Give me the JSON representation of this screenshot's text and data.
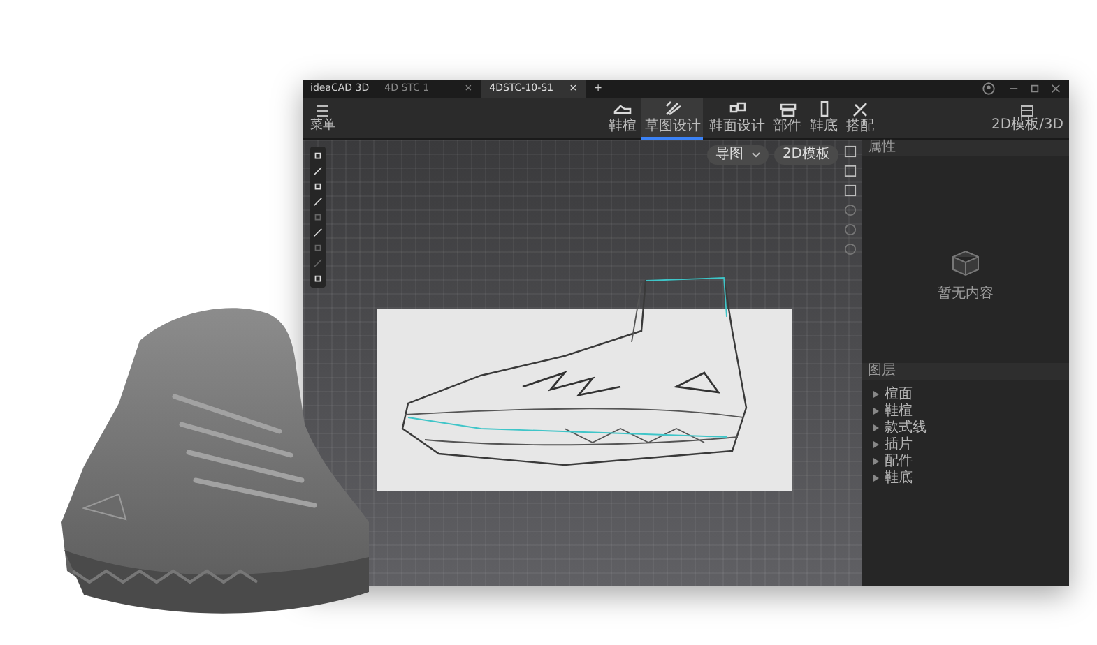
{
  "window": {
    "app_title": "ideaCAD 3D",
    "tabs": [
      {
        "label": "4D STC 1",
        "selected": false,
        "close": "×"
      },
      {
        "label": "4DSTC-10-S1",
        "selected": true,
        "close": "×"
      }
    ],
    "new_tab": "+"
  },
  "toolbar": {
    "menu": "菜单",
    "tools": [
      {
        "label": "鞋楦",
        "selected": false
      },
      {
        "label": "草图设计",
        "selected": true
      },
      {
        "label": "鞋面设计",
        "selected": false
      },
      {
        "label": "部件",
        "selected": false
      },
      {
        "label": "鞋底",
        "selected": false
      },
      {
        "label": "搭配",
        "selected": false
      }
    ],
    "right_button": "2D模板/3D"
  },
  "canvas": {
    "dropdown": "导图",
    "button": "2D模板"
  },
  "properties_panel": {
    "title": "属性",
    "empty_text": "暂无内容"
  },
  "layers_panel": {
    "title": "图层",
    "items": [
      "楦面",
      "鞋楦",
      "款式线",
      "插片",
      "配件",
      "鞋底"
    ]
  }
}
